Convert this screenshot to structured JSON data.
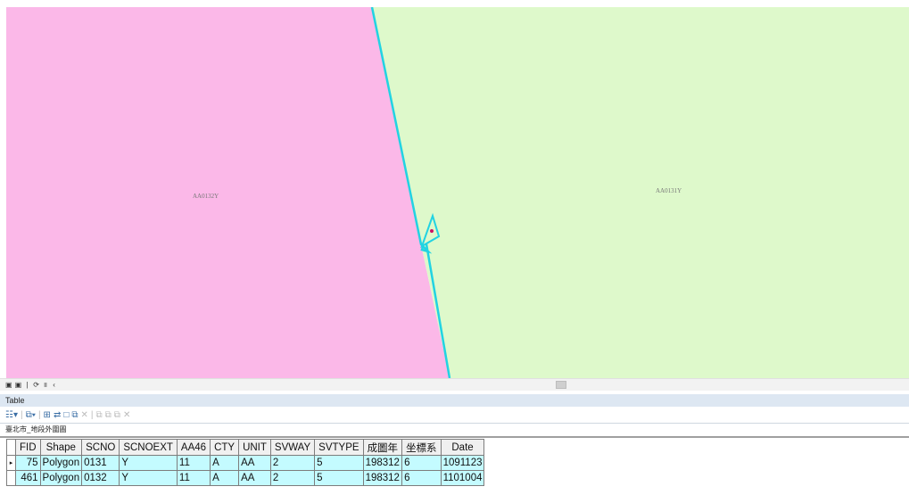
{
  "map": {
    "left_polygon_label": "AA0132Y",
    "right_polygon_label": "AA0131Y",
    "colors": {
      "left_fill": "#fbb8e8",
      "right_fill": "#def9cb",
      "boundary": "#22d3e2",
      "point": "#cc1166"
    }
  },
  "map_toolbar": {
    "buttons": [
      "▣",
      "▣",
      "|",
      "⟳",
      "॥",
      "‹"
    ]
  },
  "table_window": {
    "title": "Table",
    "layer_tab": "臺北市_地段外圍圖"
  },
  "table": {
    "columns": [
      "FID",
      "Shape",
      "SCNO",
      "SCNOEXT",
      "AA46",
      "CTY",
      "UNIT",
      "SVWAY",
      "SVTYPE",
      "成圖年",
      "坐標系",
      "Date"
    ],
    "rows": [
      {
        "FID": "75",
        "Shape": "Polygon",
        "SCNO": "0131",
        "SCNOEXT": "Y",
        "AA46": "11",
        "CTY": "A",
        "UNIT": "AA",
        "SVWAY": "2",
        "SVTYPE": "5",
        "成圖年": "198312",
        "坐標系": "6",
        "Date": "1091123",
        "selected": true
      },
      {
        "FID": "461",
        "Shape": "Polygon",
        "SCNO": "0132",
        "SCNOEXT": "Y",
        "AA46": "11",
        "CTY": "A",
        "UNIT": "AA",
        "SVWAY": "2",
        "SVTYPE": "5",
        "成圖年": "198312",
        "坐標系": "6",
        "Date": "1101004",
        "selected": false
      }
    ]
  }
}
